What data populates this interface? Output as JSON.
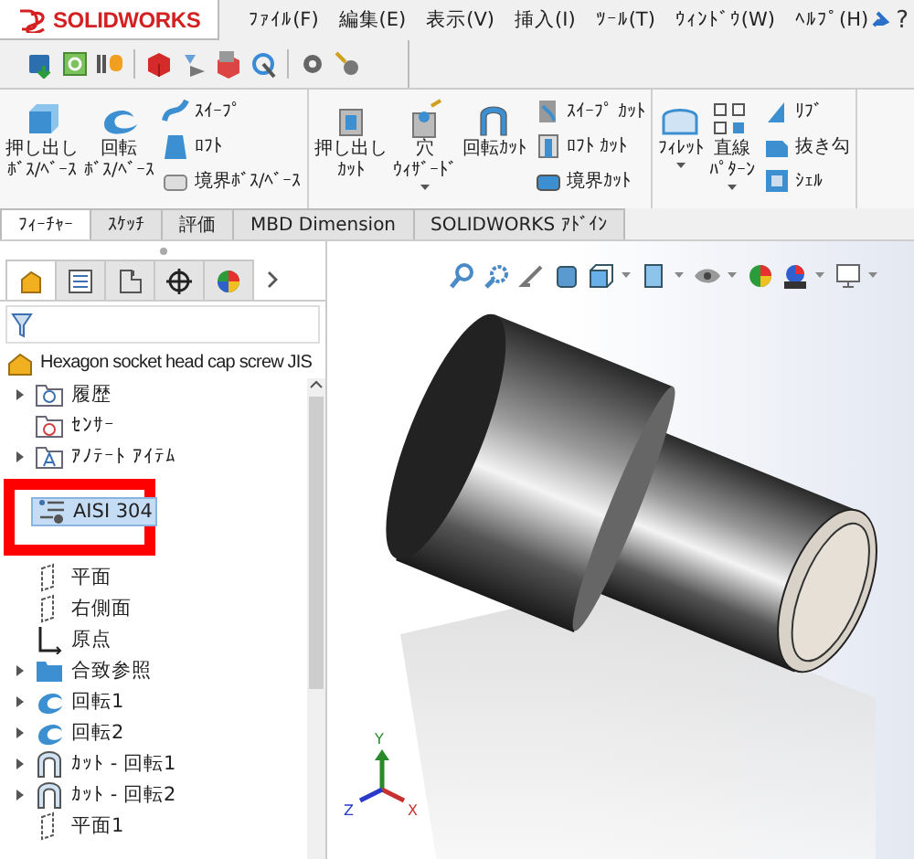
{
  "app": {
    "logo": "SOLIDWORKS"
  },
  "menu": [
    "ﾌｧｲﾙ(F)",
    "編集(E)",
    "表示(V)",
    "挿入(I)",
    "ﾂｰﾙ(T)",
    "ｳｨﾝﾄﾞｳ(W)",
    "ﾍﾙﾌﾟ(H)"
  ],
  "help": "?",
  "ribbon": [
    {
      "large": [
        {
          "lines": [
            "押し出し",
            "ﾎﾞｽ/ﾍﾞｰｽ"
          ],
          "dropdown": false
        },
        {
          "lines": [
            "回転",
            "ﾎﾞｽ/ﾍﾞｰｽ"
          ],
          "dropdown": false
        }
      ],
      "small": [
        "ｽｲｰﾌﾟ",
        "ﾛﾌﾄ",
        "境界ﾎﾞｽ/ﾍﾞｰｽ"
      ]
    },
    {
      "large": [
        {
          "lines": [
            "押し出し",
            "ｶｯﾄ"
          ],
          "dropdown": false
        },
        {
          "lines": [
            "穴",
            "ｳｨｻﾞｰﾄﾞ"
          ],
          "dropdown": true
        },
        {
          "lines": [
            "回転ｶｯﾄ"
          ],
          "dropdown": false
        }
      ],
      "small": [
        "ｽｲｰﾌﾟ ｶｯﾄ",
        "ﾛﾌﾄ ｶｯﾄ",
        "境界ｶｯﾄ"
      ]
    },
    {
      "large": [
        {
          "lines": [
            "ﾌｨﾚｯﾄ"
          ],
          "dropdown": true
        },
        {
          "lines": [
            "直線",
            "ﾊﾟﾀｰﾝ"
          ],
          "dropdown": true
        }
      ],
      "small": [
        "ﾘﾌﾞ",
        "抜き勾",
        "ｼｪﾙ"
      ]
    }
  ],
  "tabs": [
    {
      "label": "ﾌｨｰﾁｬｰ",
      "selected": true
    },
    {
      "label": "ｽｹｯﾁ",
      "selected": false
    },
    {
      "label": "評価",
      "selected": false
    },
    {
      "label": "MBD Dimension",
      "selected": false
    },
    {
      "label": "SOLIDWORKS ｱﾄﾞｲﾝ",
      "selected": false
    }
  ],
  "panel_tabs": [
    {
      "selected": true
    },
    {
      "selected": false
    },
    {
      "selected": false
    },
    {
      "selected": false
    },
    {
      "selected": false
    }
  ],
  "tree": {
    "root": "Hexagon socket head cap screw JIS",
    "items": [
      {
        "label": "履歴",
        "kind": "history",
        "expander": true,
        "selected": false,
        "marked": false
      },
      {
        "label": "ｾﾝｻｰ",
        "kind": "sensor",
        "expander": false,
        "selected": false,
        "marked": false
      },
      {
        "label": "ｱﾉﾃｰﾄ ｱｲﾃﾑ",
        "kind": "annotation",
        "expander": true,
        "selected": false,
        "marked": false
      },
      {
        "label": "AISI 304",
        "kind": "material",
        "expander": false,
        "selected": true,
        "marked": true
      },
      {
        "label": "平面",
        "kind": "plane",
        "expander": false,
        "selected": false,
        "marked": false
      },
      {
        "label": "右側面",
        "kind": "plane",
        "expander": false,
        "selected": false,
        "marked": false
      },
      {
        "label": "原点",
        "kind": "origin",
        "expander": false,
        "selected": false,
        "marked": false
      },
      {
        "label": "合致参照",
        "kind": "folder",
        "expander": true,
        "selected": false,
        "marked": false
      },
      {
        "label": "回転1",
        "kind": "revolve",
        "expander": true,
        "selected": false,
        "marked": false
      },
      {
        "label": "回転2",
        "kind": "revolve",
        "expander": true,
        "selected": false,
        "marked": false
      },
      {
        "label": "ｶｯﾄ - 回転1",
        "kind": "cut",
        "expander": true,
        "selected": false,
        "marked": false
      },
      {
        "label": "ｶｯﾄ - 回転2",
        "kind": "cut",
        "expander": true,
        "selected": false,
        "marked": false
      },
      {
        "label": "平面1",
        "kind": "plane",
        "expander": false,
        "selected": false,
        "marked": false
      }
    ]
  },
  "triad": {
    "x": "X",
    "y": "Y",
    "z": "Z"
  }
}
